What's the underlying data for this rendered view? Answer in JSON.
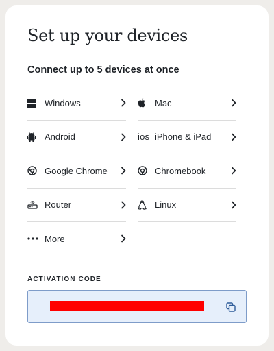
{
  "card": {
    "title": "Set up your devices",
    "subtitle": "Connect up to 5 devices at once"
  },
  "devices": {
    "left": [
      {
        "label": "Windows",
        "icon": "windows-icon"
      },
      {
        "label": "Android",
        "icon": "android-icon"
      },
      {
        "label": "Google Chrome",
        "icon": "chrome-icon"
      },
      {
        "label": "Router",
        "icon": "router-icon"
      },
      {
        "label": "More",
        "icon": "more-dots-icon"
      }
    ],
    "right": [
      {
        "label": "Mac",
        "icon": "apple-icon"
      },
      {
        "label": "iPhone & iPad",
        "icon": "ios-icon",
        "icon_text": "ios"
      },
      {
        "label": "Chromebook",
        "icon": "chrome-icon"
      },
      {
        "label": "Linux",
        "icon": "linux-icon"
      }
    ]
  },
  "activation": {
    "label": "ACTIVATION CODE",
    "code": "",
    "copy_icon": "copy-icon"
  },
  "colors": {
    "code_box_bg": "#e6effb",
    "code_box_border": "#7e9cc9",
    "redaction": "#ff0000",
    "copy_icon": "#2f5d9a"
  }
}
